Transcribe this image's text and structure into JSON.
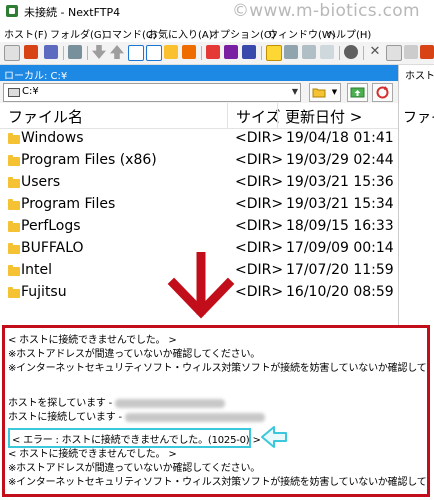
{
  "window": {
    "title": "未接続 - NextFTP4",
    "watermark": "©www.m-biotics.com"
  },
  "menu": [
    "ホスト(F)",
    "フォルダ(G)",
    "コマンド(C)",
    "お気に入り(A)",
    "オプション(O)",
    "ウィンドウ(W)",
    "ヘルプ(H)"
  ],
  "local": {
    "header": "ローカル: C:¥",
    "path": "C:¥"
  },
  "remote": {
    "header": "ホスト",
    "column": "ファイ"
  },
  "filelist": {
    "columns": {
      "name": "ファイル名",
      "size": "サイズ",
      "date": "更新日付 >"
    },
    "rows": [
      {
        "name": "Windows",
        "size": "<DIR>",
        "date": "19/04/18 01:41"
      },
      {
        "name": "Program Files (x86)",
        "size": "<DIR>",
        "date": "19/03/29 02:44"
      },
      {
        "name": "Users",
        "size": "<DIR>",
        "date": "19/03/21 15:36"
      },
      {
        "name": "Program Files",
        "size": "<DIR>",
        "date": "19/03/21 15:34"
      },
      {
        "name": "PerfLogs",
        "size": "<DIR>",
        "date": "18/09/15 16:33"
      },
      {
        "name": "BUFFALO",
        "size": "<DIR>",
        "date": "17/09/09 00:14"
      },
      {
        "name": "Intel",
        "size": "<DIR>",
        "date": "17/07/20 11:59"
      },
      {
        "name": "Fujitsu",
        "size": "<DIR>",
        "date": "16/10/20 08:59"
      }
    ]
  },
  "log": {
    "lines": [
      "< ホストに接続できませんでした。 >",
      "※ホストアドレスが間違っていないか確認してください。",
      "※インターネットセキュリティソフト・ウィルス対策ソフトが接続を妨害していないか確認してください。",
      "",
      "ホストを探しています -",
      "ホストに接続しています -",
      "< エラー : ホストに接続できませんでした。(1025-0) >",
      "< ホストに接続できませんでした。 >",
      "※ホストアドレスが間違っていないか確認してください。",
      "※インターネットセキュリティソフト・ウィルス対策ソフトが接続を妨害していないか確認してください。"
    ]
  },
  "colors": {
    "local_header": "#1e88e5",
    "annotation_red": "#c20e1a",
    "highlight_cyan": "#3cc8dc",
    "folder": "#f5c233"
  }
}
